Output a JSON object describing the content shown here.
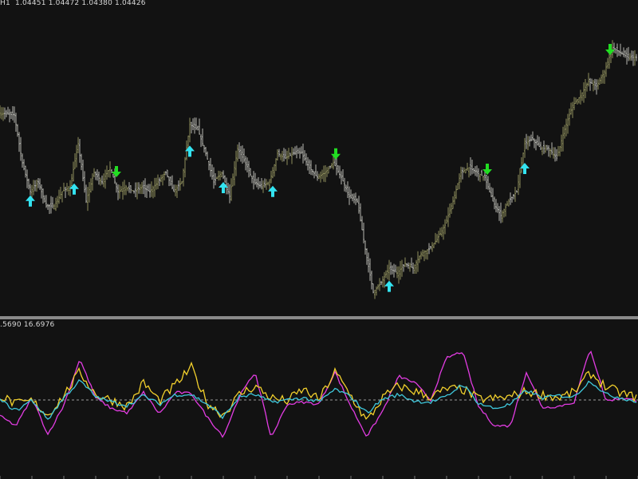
{
  "main_header": "H1  1.04451 1.04472 1.04380 1.04426",
  "indicator_header": ".5690 16.6976",
  "colors": {
    "background": "#121212",
    "price_bars_up": "#8e8e5c",
    "price_bars_down": "#b7b7b0",
    "arrow_buy": "#33e3f0",
    "arrow_sell": "#22dd22",
    "osc_magenta": "#e23ce2",
    "osc_yellow": "#f2d02c",
    "osc_cyan": "#3fc8dc",
    "zero_line": "#9a9a9a"
  },
  "chart_data": [
    {
      "type": "line",
      "title": "",
      "xlabel": "",
      "ylabel": "",
      "y_scale": "price (unlabeled)",
      "x": [
        0,
        20,
        30,
        40,
        50,
        60,
        70,
        80,
        90,
        100,
        110,
        120,
        130,
        140,
        150,
        160,
        170,
        180,
        190,
        200,
        210,
        220,
        230,
        240,
        250,
        260,
        270,
        280,
        290,
        300,
        310,
        320,
        330,
        340,
        350,
        360,
        370,
        380,
        390,
        400,
        410,
        420,
        430,
        440,
        450,
        460,
        470,
        480,
        490,
        500,
        510,
        520,
        530,
        540,
        550,
        560,
        570,
        580,
        590,
        600,
        610,
        620,
        630,
        640,
        650,
        660,
        670,
        680,
        690,
        700,
        710,
        720,
        730,
        740,
        750,
        760,
        770,
        780,
        790,
        800
      ],
      "series": [
        {
          "values": [
            1.0402,
            1.04,
            1.035,
            1.032,
            1.033,
            1.0305,
            1.0305,
            1.032,
            1.0325,
            1.037,
            1.031,
            1.034,
            1.033,
            1.0345,
            1.032,
            1.0325,
            1.032,
            1.0325,
            1.032,
            1.033,
            1.034,
            1.032,
            1.033,
            1.039,
            1.0385,
            1.036,
            1.033,
            1.034,
            1.0315,
            1.0365,
            1.035,
            1.033,
            1.0325,
            1.033,
            1.036,
            1.0355,
            1.036,
            1.036,
            1.0345,
            1.0335,
            1.034,
            1.035,
            1.0335,
            1.0315,
            1.031,
            1.026,
            1.0215,
            1.0225,
            1.024,
            1.0235,
            1.0245,
            1.024,
            1.0255,
            1.026,
            1.027,
            1.0285,
            1.031,
            1.034,
            1.0345,
            1.034,
            1.0335,
            1.031,
            1.0295,
            1.031,
            1.032,
            1.037,
            1.0375,
            1.0365,
            1.0365,
            1.0355,
            1.0385,
            1.041,
            1.042,
            1.0435,
            1.043,
            1.0445,
            1.047,
            1.0465,
            1.046,
            1.046
          ]
        }
      ],
      "buy_arrows_x": [
        38,
        93,
        238,
        280,
        342,
        488,
        658
      ],
      "sell_arrows_x": [
        146,
        421,
        611,
        765
      ]
    },
    {
      "type": "line",
      "title": "",
      "xlabel": "",
      "ylabel": "",
      "ylim": [
        -5,
        5
      ],
      "zero_line": "dashed",
      "x": [
        0,
        20,
        40,
        60,
        80,
        100,
        120,
        140,
        160,
        180,
        200,
        220,
        240,
        260,
        280,
        300,
        320,
        340,
        360,
        380,
        400,
        420,
        440,
        460,
        480,
        500,
        520,
        540,
        560,
        580,
        600,
        620,
        640,
        660,
        680,
        700,
        720,
        740,
        760,
        780,
        800
      ],
      "series": [
        {
          "values": [
            -1.5,
            -2.4,
            0.2,
            -3.2,
            -0.5,
            3.8,
            0.2,
            -0.8,
            -1.2,
            0.7,
            -1.3,
            0.7,
            0.6,
            -1.6,
            -3.4,
            0.3,
            2.6,
            -3.5,
            -0.4,
            -0.2,
            -0.4,
            2.6,
            -0.6,
            -3.4,
            -1.0,
            2.2,
            1.6,
            0.0,
            3.9,
            4.5,
            -0.6,
            -2.4,
            -2.4,
            2.6,
            -0.7,
            -0.6,
            -0.2,
            4.8,
            -0.1,
            0.2,
            -0.1
          ]
        },
        {
          "values": [
            0.4,
            -0.4,
            -0.1,
            -1.4,
            0.4,
            2.6,
            0.5,
            0.0,
            -0.6,
            1.6,
            -0.1,
            1.4,
            3.0,
            -0.3,
            -1.4,
            0.5,
            1.3,
            0.2,
            -0.1,
            1.0,
            0.0,
            2.6,
            0.4,
            -2.0,
            0.2,
            1.3,
            0.8,
            0.3,
            1.0,
            1.0,
            0.1,
            0.1,
            0.3,
            0.8,
            0.5,
            0.2,
            0.7,
            2.5,
            1.2,
            0.6,
            0.2
          ]
        },
        {
          "values": [
            0.0,
            -1.0,
            0.0,
            -1.8,
            0.2,
            1.8,
            0.3,
            -0.2,
            -0.5,
            0.4,
            -0.4,
            0.5,
            0.5,
            -0.4,
            -1.6,
            0.3,
            0.5,
            -0.2,
            0.0,
            0.2,
            -0.2,
            1.0,
            0.3,
            -1.2,
            0.1,
            0.5,
            -0.1,
            -0.2,
            0.3,
            1.5,
            -0.3,
            -0.8,
            -0.4,
            0.9,
            0.2,
            0.4,
            0.3,
            1.8,
            0.5,
            0.2,
            -0.2
          ]
        }
      ]
    }
  ]
}
